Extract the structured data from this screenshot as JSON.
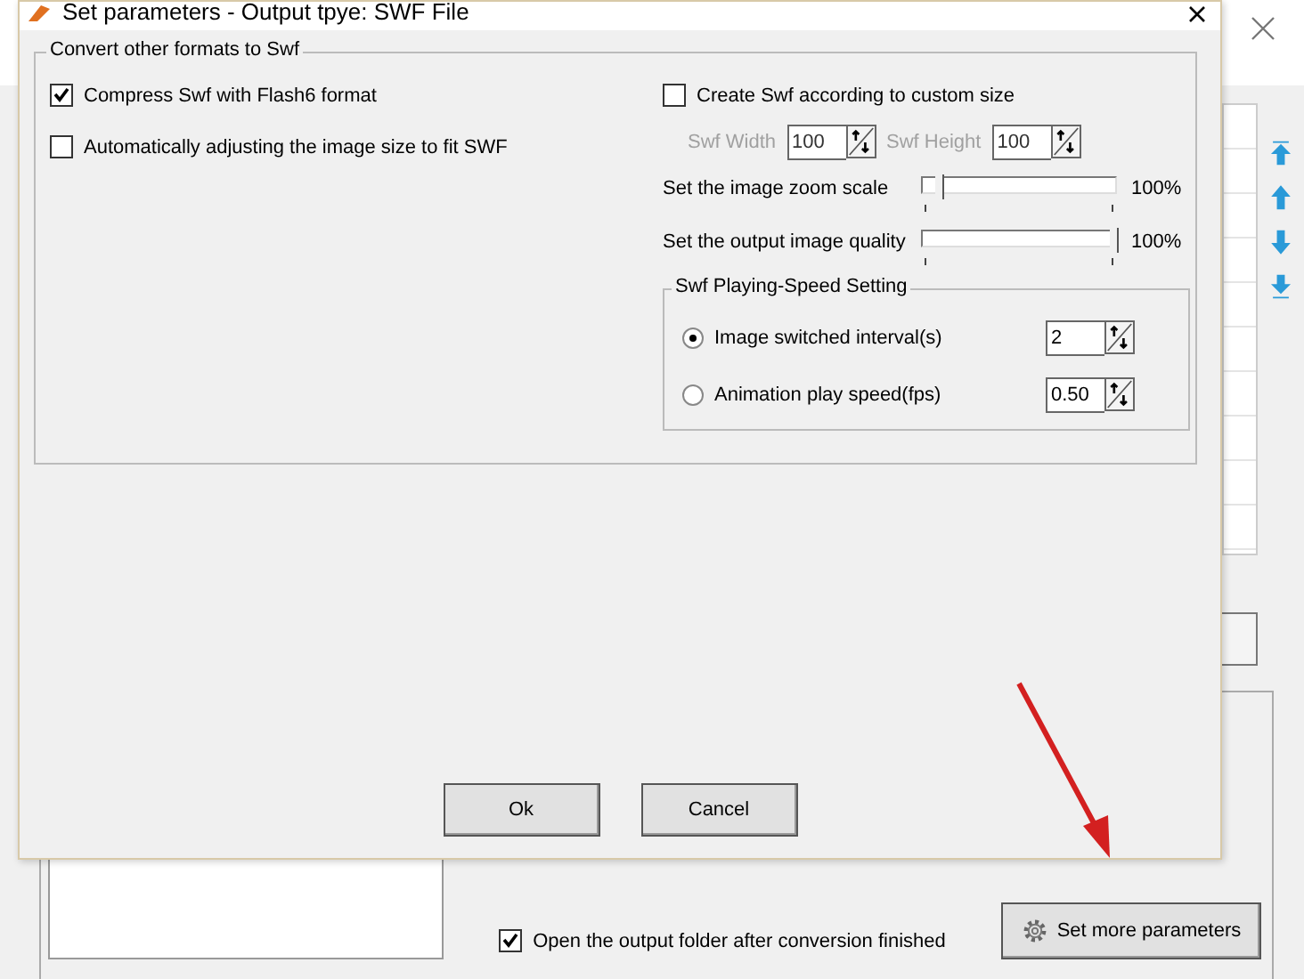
{
  "dialog": {
    "title": "Set parameters - Output tpye: SWF File",
    "group": {
      "title": "Convert other formats to Swf",
      "left_options": [
        {
          "label": "Compress Swf with Flash6 format",
          "checked": true
        },
        {
          "label": "Automatically adjusting the image size to fit SWF",
          "checked": false
        }
      ],
      "custom_size": {
        "label": "Create Swf according to custom size",
        "checked": false,
        "fields": [
          {
            "label": "Swf Width",
            "value": "100",
            "disabled": true
          },
          {
            "label": "Swf Height",
            "value": "100",
            "disabled": true
          }
        ]
      },
      "sliders": [
        {
          "label": "Set the image zoom scale",
          "level": 0.08,
          "reading": "100%"
        },
        {
          "label": "Set the output image quality",
          "level": 1,
          "reading": "100%"
        }
      ],
      "speed": {
        "title": "Swf Playing-Speed Setting",
        "options": [
          {
            "label": "Image switched interval(s)",
            "selected": true,
            "value": "2"
          },
          {
            "label": "Animation play speed(fps)",
            "selected": false,
            "value": "0.50"
          }
        ]
      }
    },
    "buttons": [
      "Ok",
      "Cancel"
    ]
  },
  "background": {
    "open_folder": {
      "label": "Open the output folder after conversion finished",
      "checked": true
    },
    "more_button": "Set more parameters"
  }
}
